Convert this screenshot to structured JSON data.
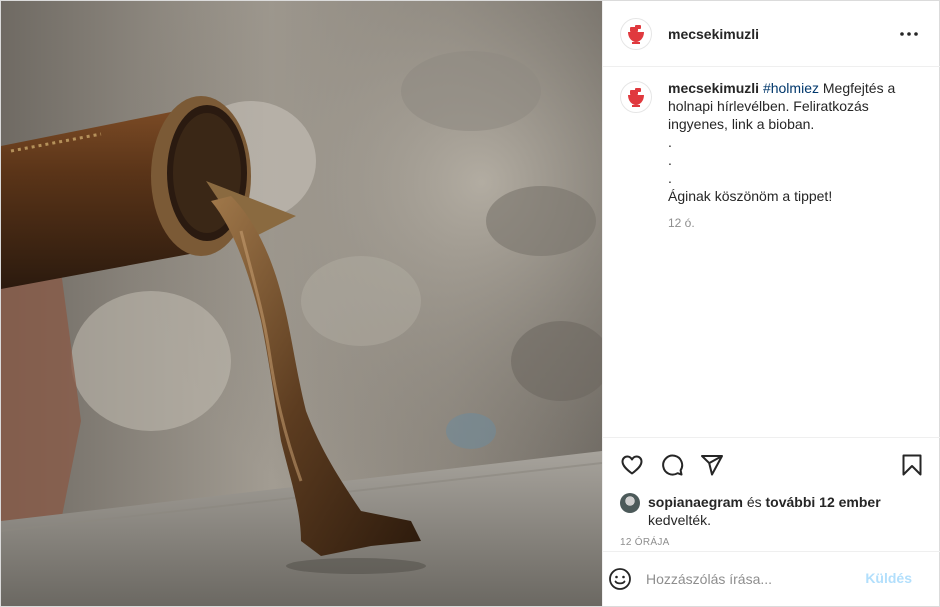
{
  "post": {
    "username": "mecsekimuzli",
    "more_icon": "more-horizontal-icon",
    "caption": {
      "username": "mecsekimuzli",
      "hashtag": "#holmiez",
      "text": " Megfejtés a holnapi hírlevélben. Feliratkozás ingyenes, link a bioban.",
      "dots": [
        ".",
        ".",
        "."
      ],
      "thanks": "Áginak köszönöm a tippet!",
      "time": "12 ó."
    },
    "actions": {
      "like_icon": "heart-icon",
      "comment_icon": "comment-bubble-icon",
      "share_icon": "paper-plane-icon",
      "save_icon": "bookmark-icon"
    },
    "likes": {
      "user": "sopianaegram",
      "middle": " és ",
      "others": "további 12 ember",
      "end": "kedvelték."
    },
    "timestamp": "12 ÓRÁJA",
    "comment_box": {
      "emoji_icon": "smiley-icon",
      "placeholder": "Hozzászólás írása...",
      "send_label": "Küldés",
      "send_color": "#b2dffc"
    },
    "colors": {
      "hashtag": "#00376b",
      "text": "#262626",
      "muted": "#8e8e8e",
      "border": "#dbdbdb"
    }
  }
}
